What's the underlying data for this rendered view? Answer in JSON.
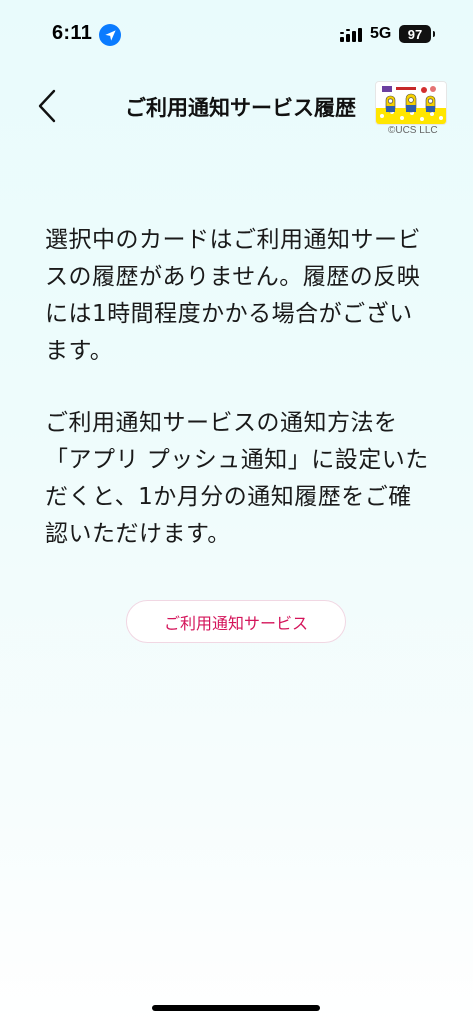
{
  "status_bar": {
    "time": "6:11",
    "network": "5G",
    "battery": "97"
  },
  "nav": {
    "title": "ご利用通知サービス履歴",
    "copyright": "©UCS LLC"
  },
  "content": {
    "message_1": "選択中のカードはご利用通知サービスの履歴がありません。履歴の反映には1時間程度かかる場合がございます。",
    "message_2": "ご利用通知サービスの通知方法を「アプリ プッシュ通知」に設定いただくと、1か月分の通知履歴をご確認いただけます。",
    "service_button_label": "ご利用通知サービス"
  },
  "colors": {
    "accent": "#d4145a",
    "location": "#0a7bff"
  },
  "icons": {
    "back": "chevron-left-icon",
    "location": "location-arrow-icon",
    "signal": "cellular-signal-icon",
    "battery": "battery-icon"
  }
}
